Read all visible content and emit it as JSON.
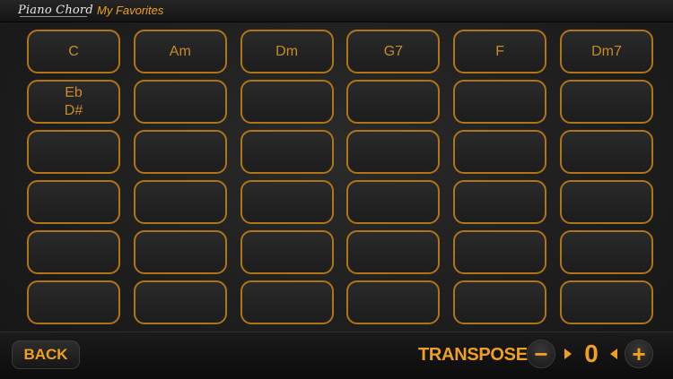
{
  "header": {
    "logo": "Piano Chord",
    "title": "My Favorites"
  },
  "grid": {
    "rows": [
      [
        [
          "C"
        ],
        [
          "Am"
        ],
        [
          "Dm"
        ],
        [
          "G7"
        ],
        [
          "F"
        ],
        [
          "Dm7"
        ]
      ],
      [
        [
          "Eb",
          "D#"
        ],
        [],
        [],
        [],
        [],
        []
      ],
      [
        [],
        [],
        [],
        [],
        [],
        []
      ],
      [
        [],
        [],
        [],
        [],
        [],
        []
      ],
      [
        [],
        [],
        [],
        [],
        [],
        []
      ],
      [
        [],
        [],
        [],
        [],
        [],
        []
      ]
    ]
  },
  "footer": {
    "back_label": "BACK",
    "transpose_label": "TRANSPOSE",
    "minus_label": "−",
    "plus_label": "+",
    "transpose_value": "0"
  },
  "colors": {
    "accent": "#f0a020",
    "cell_border": "#b07515",
    "cell_text": "#c88a2a",
    "background": "#1e1e1e"
  }
}
